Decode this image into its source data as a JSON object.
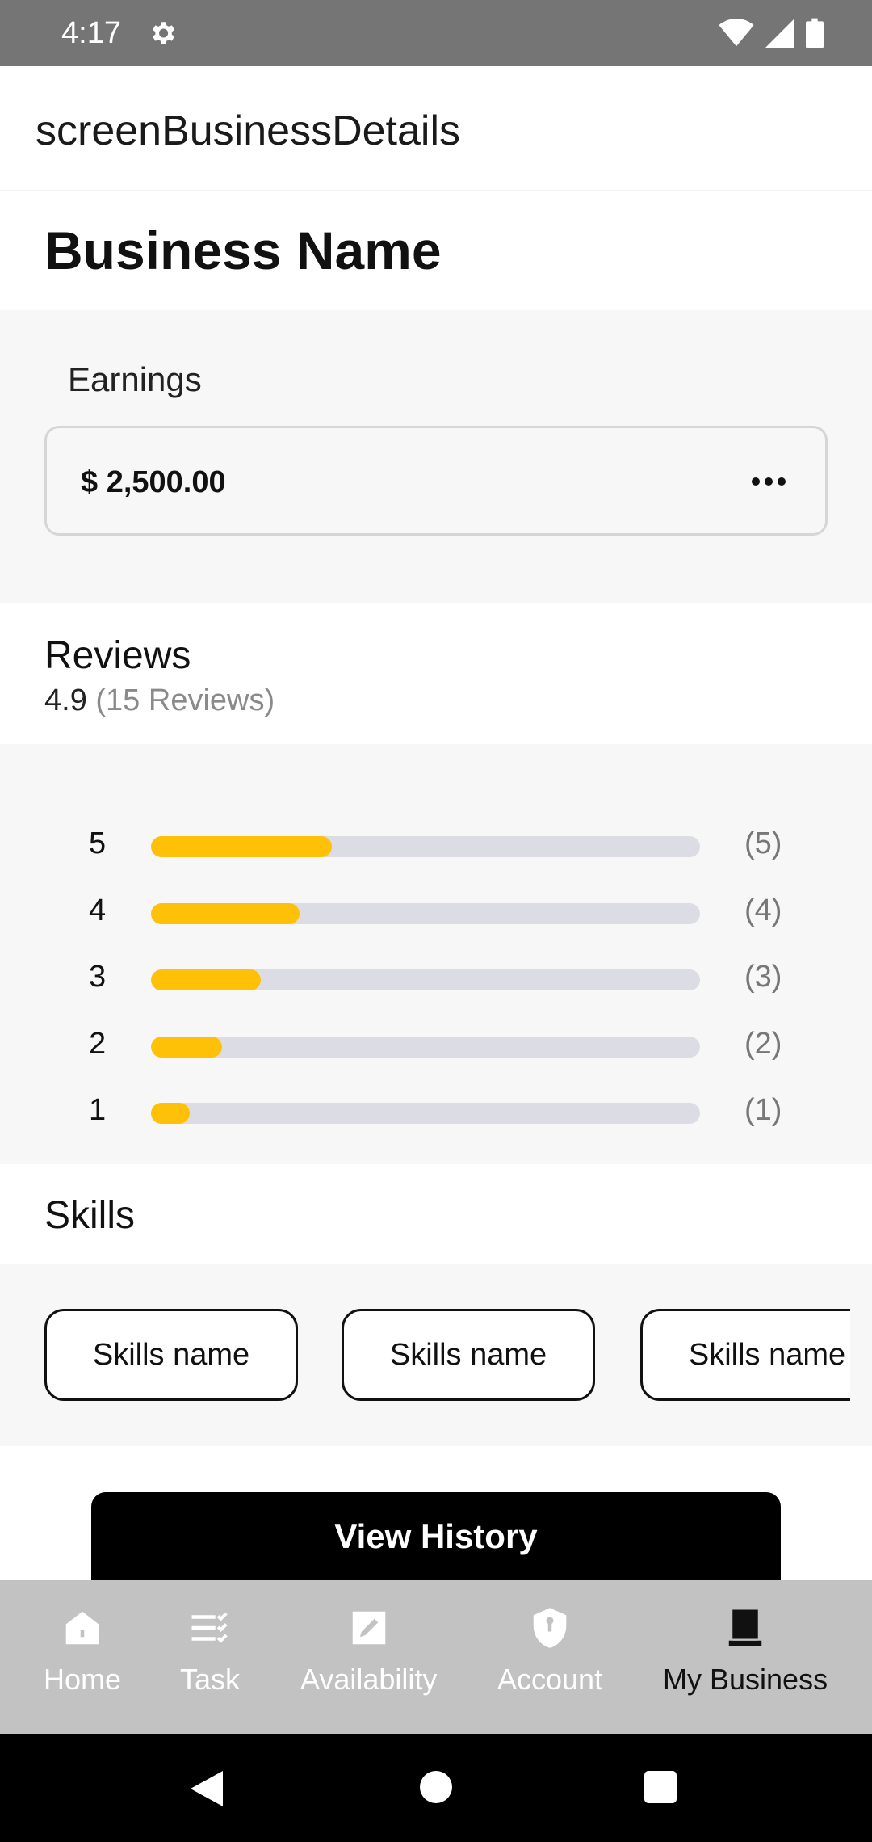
{
  "status_bar": {
    "time": "4:17"
  },
  "app_bar": {
    "title": "screenBusinessDetails"
  },
  "business": {
    "name": "Business Name"
  },
  "earnings": {
    "label": "Earnings",
    "amount": "$ 2,500.00"
  },
  "reviews": {
    "title": "Reviews",
    "rating": "4.9",
    "count_text": "(15 Reviews)",
    "bars": [
      {
        "star": "5",
        "count": "(5)",
        "fill": 0.33
      },
      {
        "star": "4",
        "count": "(4)",
        "fill": 0.27
      },
      {
        "star": "3",
        "count": "(3)",
        "fill": 0.2
      },
      {
        "star": "2",
        "count": "(2)",
        "fill": 0.13
      },
      {
        "star": "1",
        "count": "(1)",
        "fill": 0.07
      }
    ]
  },
  "skills": {
    "title": "Skills",
    "items": [
      "Skills name",
      "Skills name",
      "Skills name"
    ]
  },
  "actions": {
    "view_history": "View History"
  },
  "bottom_nav": {
    "items": [
      {
        "label": "Home",
        "icon": "home-icon",
        "active": false
      },
      {
        "label": "Task",
        "icon": "task-list-icon",
        "active": false
      },
      {
        "label": "Availability",
        "icon": "edit-calendar-icon",
        "active": false
      },
      {
        "label": "Account",
        "icon": "shield-icon",
        "active": false
      },
      {
        "label": "My Business",
        "icon": "book-icon",
        "active": true
      }
    ]
  },
  "colors": {
    "accent": "#ffc107",
    "track": "#dcdde4",
    "nav_bg": "#c2c2c2",
    "status_bg": "#757575"
  }
}
